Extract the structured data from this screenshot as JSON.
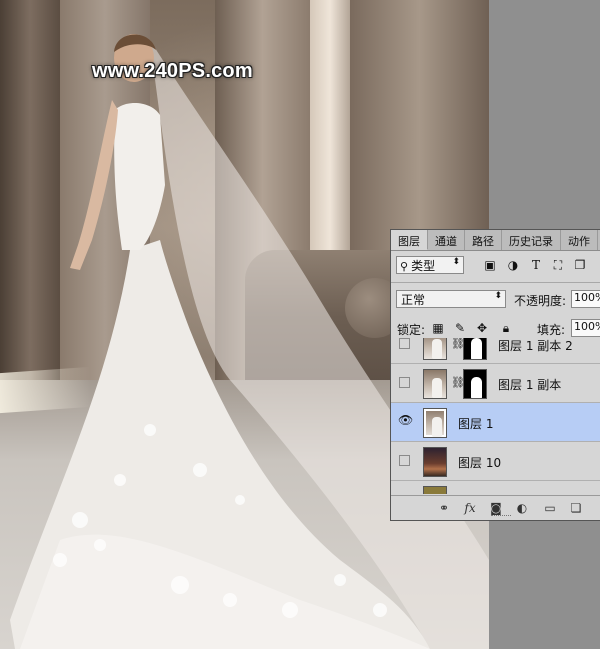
{
  "watermark": "www.240PS.com",
  "panel": {
    "tabs": [
      "图层",
      "通道",
      "路径",
      "历史记录",
      "动作"
    ],
    "filter_kind": "类型",
    "filter_icons": [
      "image-filter-icon",
      "adjustment-filter-icon",
      "type-filter-icon",
      "shape-filter-icon",
      "smart-object-filter-icon"
    ],
    "filter_type_glyph": "T",
    "blend_mode": "正常",
    "opacity_label": "不透明度:",
    "opacity_value": "100%",
    "lock_label": "锁定:",
    "fill_label": "填充:",
    "fill_value": "100%",
    "layers": [
      {
        "name": "图层 1 副本 2",
        "visible": false,
        "selected": false,
        "thumbnail": "photo",
        "has_mask": true
      },
      {
        "name": "图层 1 副本",
        "visible": false,
        "selected": false,
        "thumbnail": "photo",
        "has_mask": true
      },
      {
        "name": "图层 1",
        "visible": true,
        "selected": true,
        "thumbnail": "photo",
        "has_mask": false
      },
      {
        "name": "图层 10",
        "visible": false,
        "selected": false,
        "thumbnail": "sunset",
        "has_mask": false
      }
    ],
    "footer_icons": [
      "link-layers-icon",
      "fx-icon",
      "add-mask-icon",
      "adjustment-layer-icon",
      "new-group-icon",
      "new-layer-icon"
    ],
    "footer_fx": "fx"
  },
  "colors": {
    "selected_layer": "#b7cdf5",
    "panel_bg": "#d6d6d6"
  }
}
